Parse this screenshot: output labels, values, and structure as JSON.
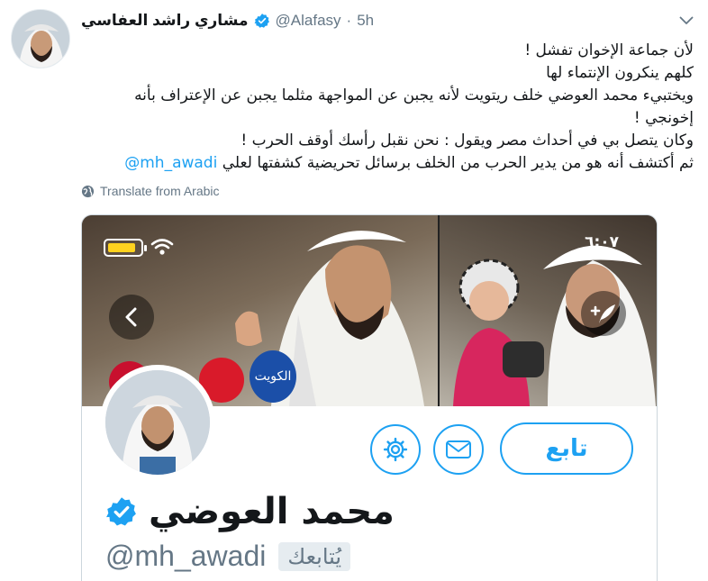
{
  "tweet": {
    "author_name": "مشاري راشد العفاسي",
    "handle": "@Alafasy",
    "separator": "·",
    "time": "5h",
    "lines": [
      "لأن جماعة الإخوان تفشل !",
      "كلهم ينكرون الإنتماء لها",
      "ويختبيء محمد العوضي خلف ريتويت لأنه يجبن عن المواجهة مثلما يجبن عن الإعتراف بأنه",
      "إخونجي !",
      "وكان يتصل بي في أحداث مصر ويقول : نحن نقبل رأسك أوقف الحرب !"
    ],
    "last_line_text": "ثم أكتشف أنه هو من يدير الحرب من الخلف برسائل تحريضية كشفتها لعلي",
    "mention": "@mh_awadi",
    "translate_label": "Translate from Arabic"
  },
  "media": {
    "status_time": "٦:٠٧",
    "follow_label": "تابع",
    "profile_name": "محمد العوضي",
    "profile_handle": "@mh_awadi",
    "follows_you": "يُتابعك",
    "mic_label": "الكويت"
  },
  "colors": {
    "accent": "#1da1f2",
    "muted": "#657786",
    "text": "#14171a"
  },
  "icons": {
    "verified": "verified-badge-icon",
    "chevron": "chevron-down-icon",
    "globe": "globe-icon",
    "battery": "battery-icon",
    "wifi": "wifi-icon",
    "back": "back-arrow-icon",
    "compose": "compose-icon",
    "settings": "gear-icon",
    "message": "envelope-icon"
  }
}
